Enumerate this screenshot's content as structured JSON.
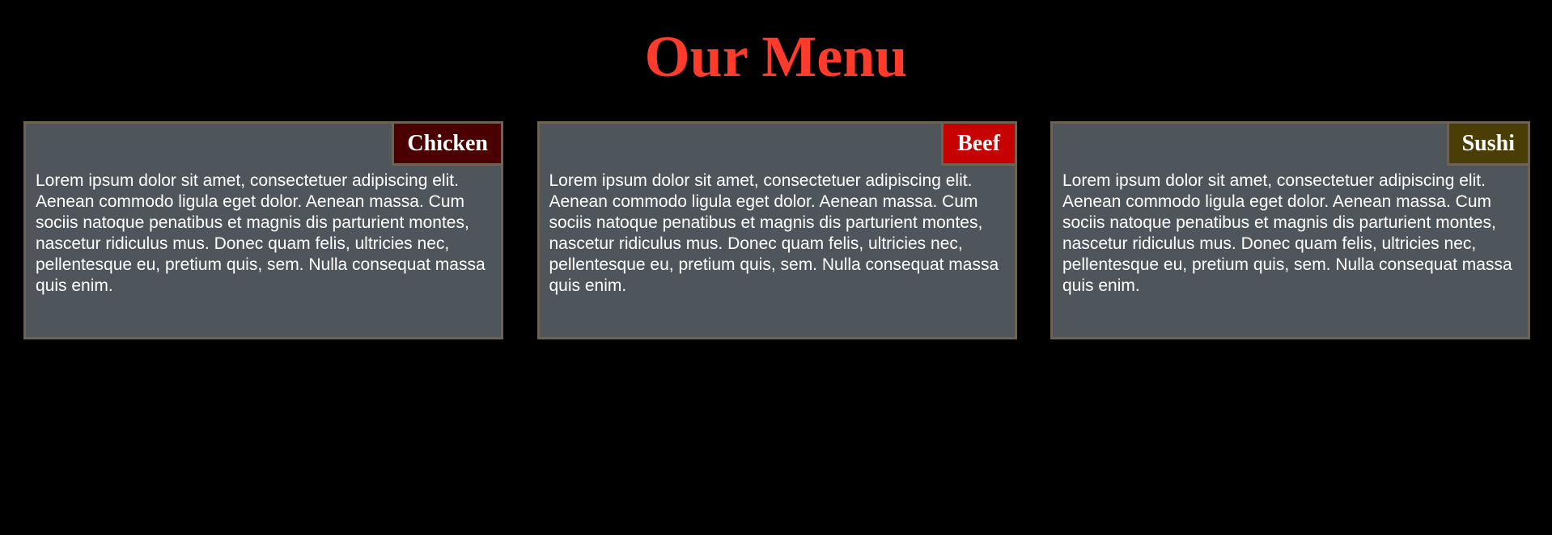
{
  "page": {
    "title": "Our Menu",
    "title_color": "#ff3b2b",
    "background_color": "#000000"
  },
  "menu": {
    "items": [
      {
        "label": "Chicken",
        "label_bg": "#4a0000",
        "description": "Lorem ipsum dolor sit amet, consectetuer adipiscing elit. Aenean commodo ligula eget dolor. Aenean massa. Cum sociis natoque penatibus et magnis dis parturient montes, nascetur ridiculus mus. Donec quam felis, ultricies nec, pellentesque eu, pretium quis, sem. Nulla consequat massa quis enim."
      },
      {
        "label": "Beef",
        "label_bg": "#c70000",
        "description": "Lorem ipsum dolor sit amet, consectetuer adipiscing elit. Aenean commodo ligula eget dolor. Aenean massa. Cum sociis natoque penatibus et magnis dis parturient montes, nascetur ridiculus mus. Donec quam felis, ultricies nec, pellentesque eu, pretium quis, sem. Nulla consequat massa quis enim."
      },
      {
        "label": "Sushi",
        "label_bg": "#4a3d05",
        "description": "Lorem ipsum dolor sit amet, consectetuer adipiscing elit. Aenean commodo ligula eget dolor. Aenean massa. Cum sociis natoque penatibus et magnis dis parturient montes, nascetur ridiculus mus. Donec quam felis, ultricies nec, pellentesque eu, pretium quis, sem. Nulla consequat massa quis enim."
      }
    ],
    "card_bg": "#4f565b",
    "card_border": "#6d6254"
  }
}
